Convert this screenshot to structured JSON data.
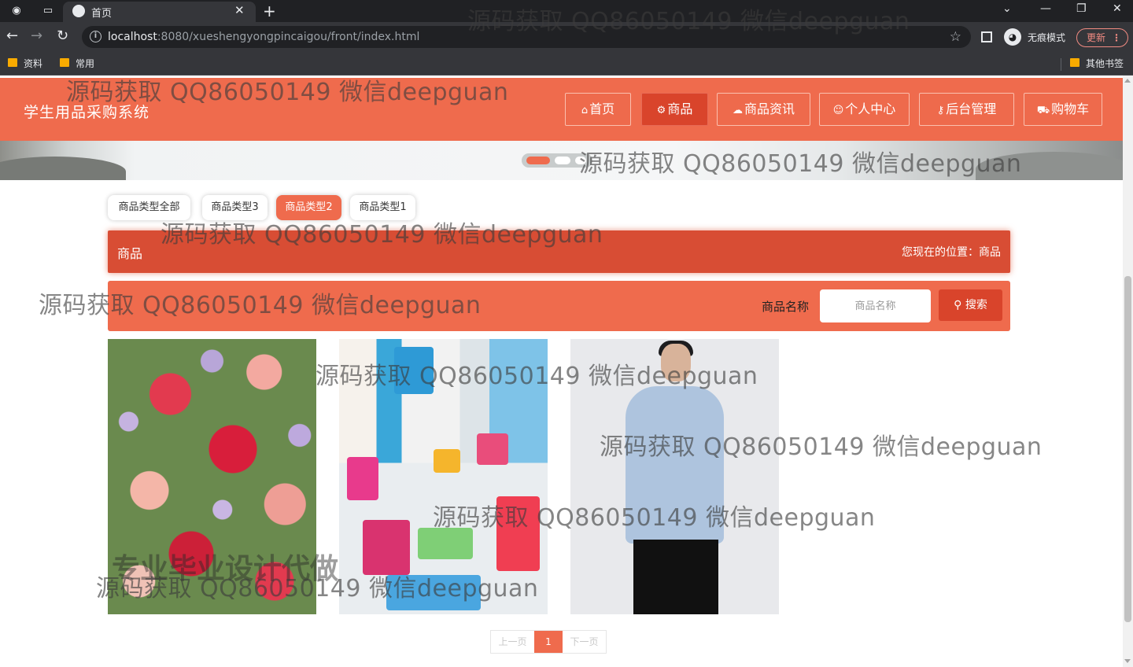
{
  "browser": {
    "tab_title": "首页",
    "url_host": "localhost",
    "url_rest": ":8080/xueshengyongpincaigou/front/index.html",
    "incognito_label": "无痕模式",
    "update_label": "更新",
    "bookmarks": [
      "资料",
      "常用"
    ],
    "other_bookmarks": "其他书签"
  },
  "site": {
    "title": "学生用品采购系统",
    "nav": [
      {
        "icon": "⌂",
        "label": "首页"
      },
      {
        "icon": "⚙",
        "label": "商品"
      },
      {
        "icon": "☁",
        "label": "商品资讯"
      },
      {
        "icon": "☺",
        "label": "个人中心"
      },
      {
        "icon": "⚷",
        "label": "后台管理"
      },
      {
        "icon": "⛟",
        "label": "购物车"
      }
    ],
    "active_nav": "商品"
  },
  "types": [
    "商品类型全部",
    "商品类型3",
    "商品类型2",
    "商品类型1"
  ],
  "active_type": "商品类型2",
  "breadcrumb": {
    "title": "商品",
    "position": "您现在的位置：商品"
  },
  "search": {
    "label": "商品名称",
    "placeholder": "商品名称",
    "button": "搜索"
  },
  "products": [
    {
      "image": "roses-flowers"
    },
    {
      "image": "plastic-basins-shelf"
    },
    {
      "image": "man-blue-shirt"
    }
  ],
  "pager": {
    "prev": "上一页",
    "current": "1",
    "next": "下一页"
  },
  "watermark": "源码获取 QQ86050149 微信deepguan",
  "watermark_big": "专业毕业设计代做",
  "colors": {
    "brand": "#ef6b4d",
    "brand_dark": "#d9442b"
  }
}
